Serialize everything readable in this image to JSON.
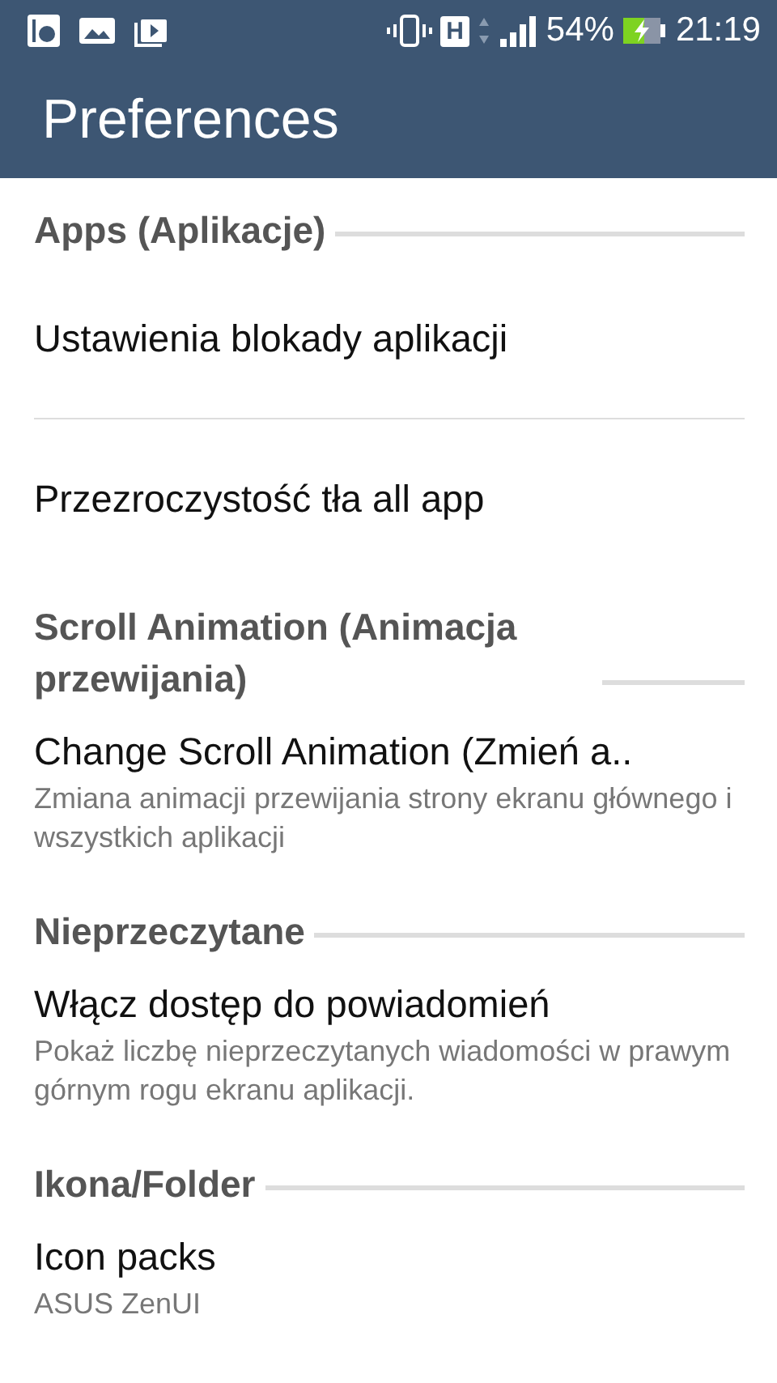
{
  "status_bar": {
    "network": "H",
    "battery": "54%",
    "time": "21:19"
  },
  "app_bar": {
    "title": "Preferences"
  },
  "list": [
    {
      "kind": "category",
      "title": "Apps (Aplikacje)"
    },
    {
      "kind": "preference",
      "title": "Ustawienia blokady aplikacji",
      "divider_after": true
    },
    {
      "kind": "preference",
      "title": "Przezroczystość tła all app",
      "divider_after": false
    },
    {
      "kind": "category",
      "title": "Scroll Animation (Animacja przewijania)"
    },
    {
      "kind": "preference",
      "title": "Change Scroll Animation (Zmień a..",
      "summary": "Zmiana animacji przewijania strony ekranu głównego i wszystkich aplikacji",
      "divider_after": false
    },
    {
      "kind": "category",
      "title": "Nieprzeczytane"
    },
    {
      "kind": "preference",
      "title": "Włącz dostęp do powiadomień",
      "summary": "Pokaż liczbę nieprzeczytanych wiadomości w prawym górnym rogu ekranu aplikacji.",
      "divider_after": false
    },
    {
      "kind": "category",
      "title": "Ikona/Folder"
    },
    {
      "kind": "preference",
      "title": "Icon packs",
      "summary": "ASUS ZenUI",
      "divider_after": false
    }
  ]
}
